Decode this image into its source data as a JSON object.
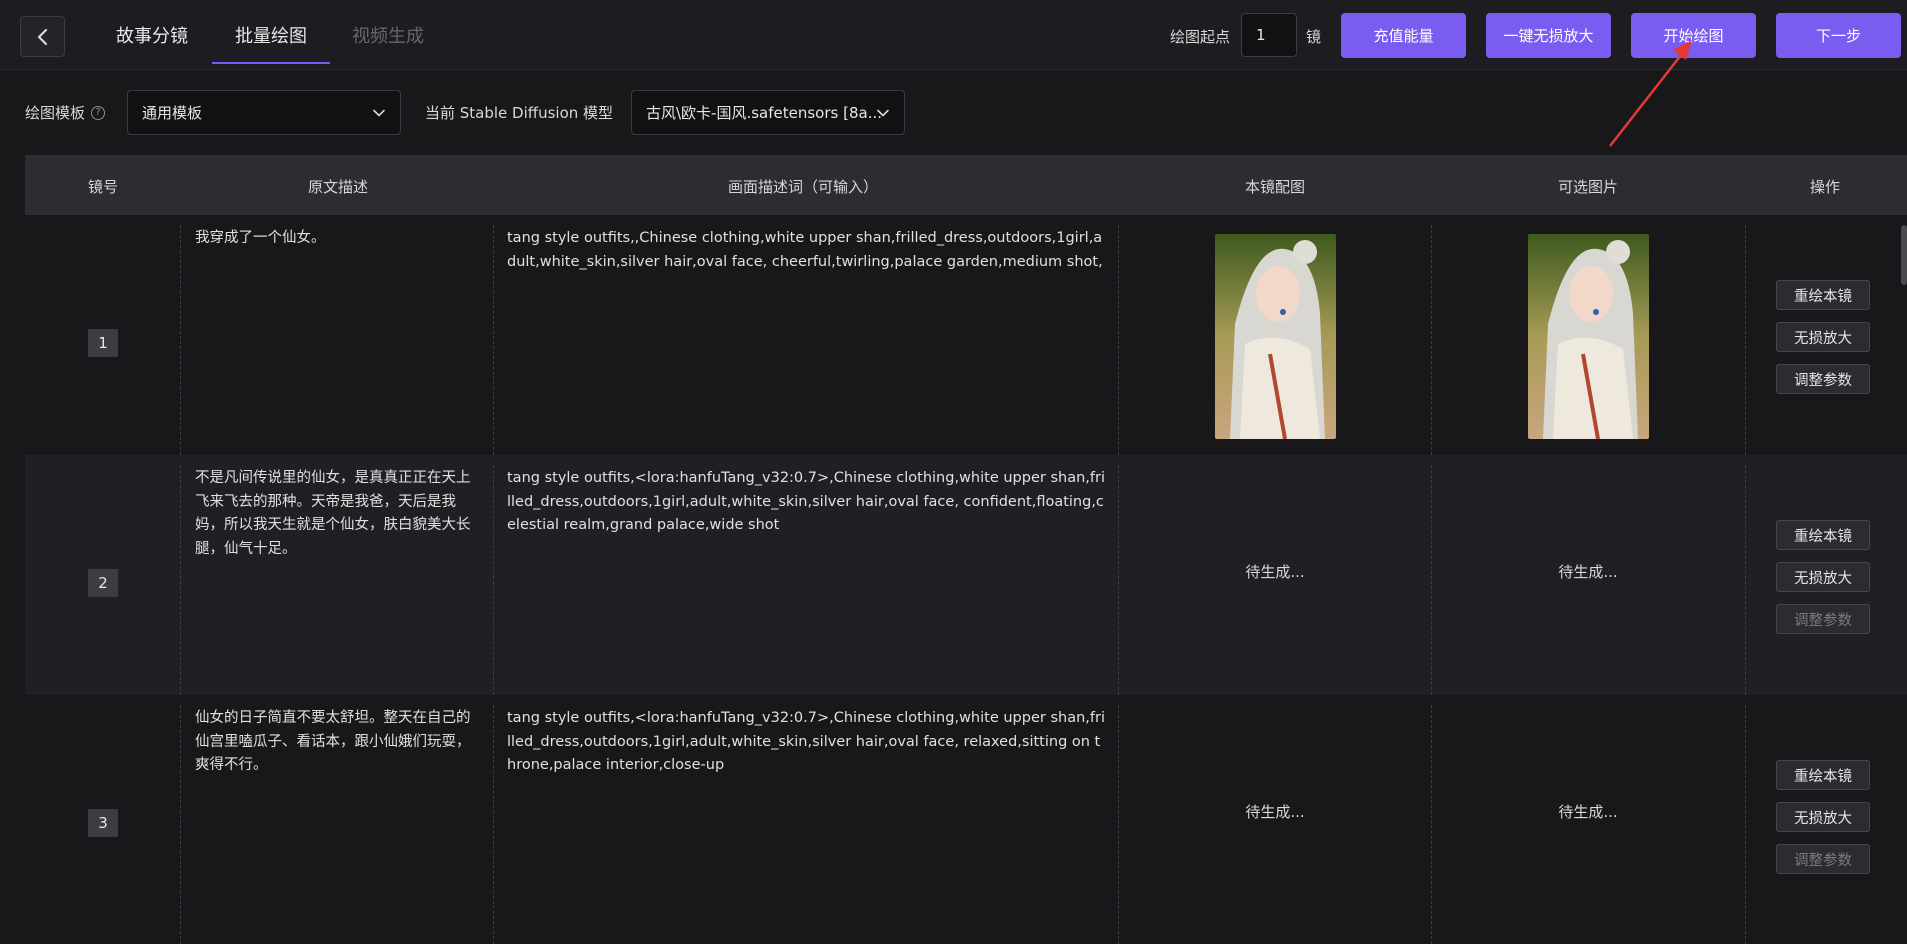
{
  "header": {
    "tabs": [
      {
        "label": "故事分镜",
        "active": false
      },
      {
        "label": "批量绘图",
        "active": true
      },
      {
        "label": "视频生成",
        "active": false
      }
    ],
    "start_label": "绘图起点",
    "start_value": "1",
    "unit_label": "镜",
    "buttons": {
      "recharge": "充值能量",
      "upscale_all": "一键无损放大",
      "start_draw": "开始绘图",
      "next": "下一步"
    },
    "accent_color": "#7b5cf0"
  },
  "toolbar": {
    "template_label": "绘图模板",
    "template_value": "通用模板",
    "model_label": "当前 Stable Diffusion 模型",
    "model_value": "古风\\欧卡-国风.safetensors [8a..."
  },
  "table": {
    "columns": [
      "镜号",
      "原文描述",
      "画面描述词（可输入）",
      "本镜配图",
      "可选图片",
      "操作"
    ],
    "rows": [
      {
        "number": "1",
        "original": "我穿成了一个仙女。",
        "prompt": "tang style outfits,,Chinese clothing,white upper shan,frilled_dress,outdoors,1girl,adult,white_skin,silver hair,oval face, cheerful,twirling,palace garden,medium shot,",
        "image_status": "",
        "option_status": "",
        "actions": [
          "重绘本镜",
          "无损放大",
          "调整参数"
        ]
      },
      {
        "number": "2",
        "original": "不是凡间传说里的仙女，是真真正正在天上飞来飞去的那种。天帝是我爸，天后是我妈，所以我天生就是个仙女，肤白貌美大长腿，仙气十足。",
        "prompt": "tang style outfits,<lora:hanfuTang_v32:0.7>,Chinese clothing,white upper shan,frilled_dress,outdoors,1girl,adult,white_skin,silver hair,oval face, confident,floating,celestial realm,grand palace,wide shot",
        "image_status": "待生成...",
        "option_status": "待生成...",
        "actions": [
          "重绘本镜",
          "无损放大",
          "调整参数"
        ]
      },
      {
        "number": "3",
        "original": "仙女的日子简直不要太舒坦。整天在自己的仙宫里嗑瓜子、看话本，跟小仙娥们玩耍，爽得不行。",
        "prompt": "tang style outfits,<lora:hanfuTang_v32:0.7>,Chinese clothing,white upper shan,frilled_dress,outdoors,1girl,adult,white_skin,silver hair,oval face, relaxed,sitting on throne,palace interior,close-up",
        "image_status": "待生成...",
        "option_status": "待生成...",
        "actions": [
          "重绘本镜",
          "无损放大",
          "调整参数"
        ]
      }
    ]
  }
}
